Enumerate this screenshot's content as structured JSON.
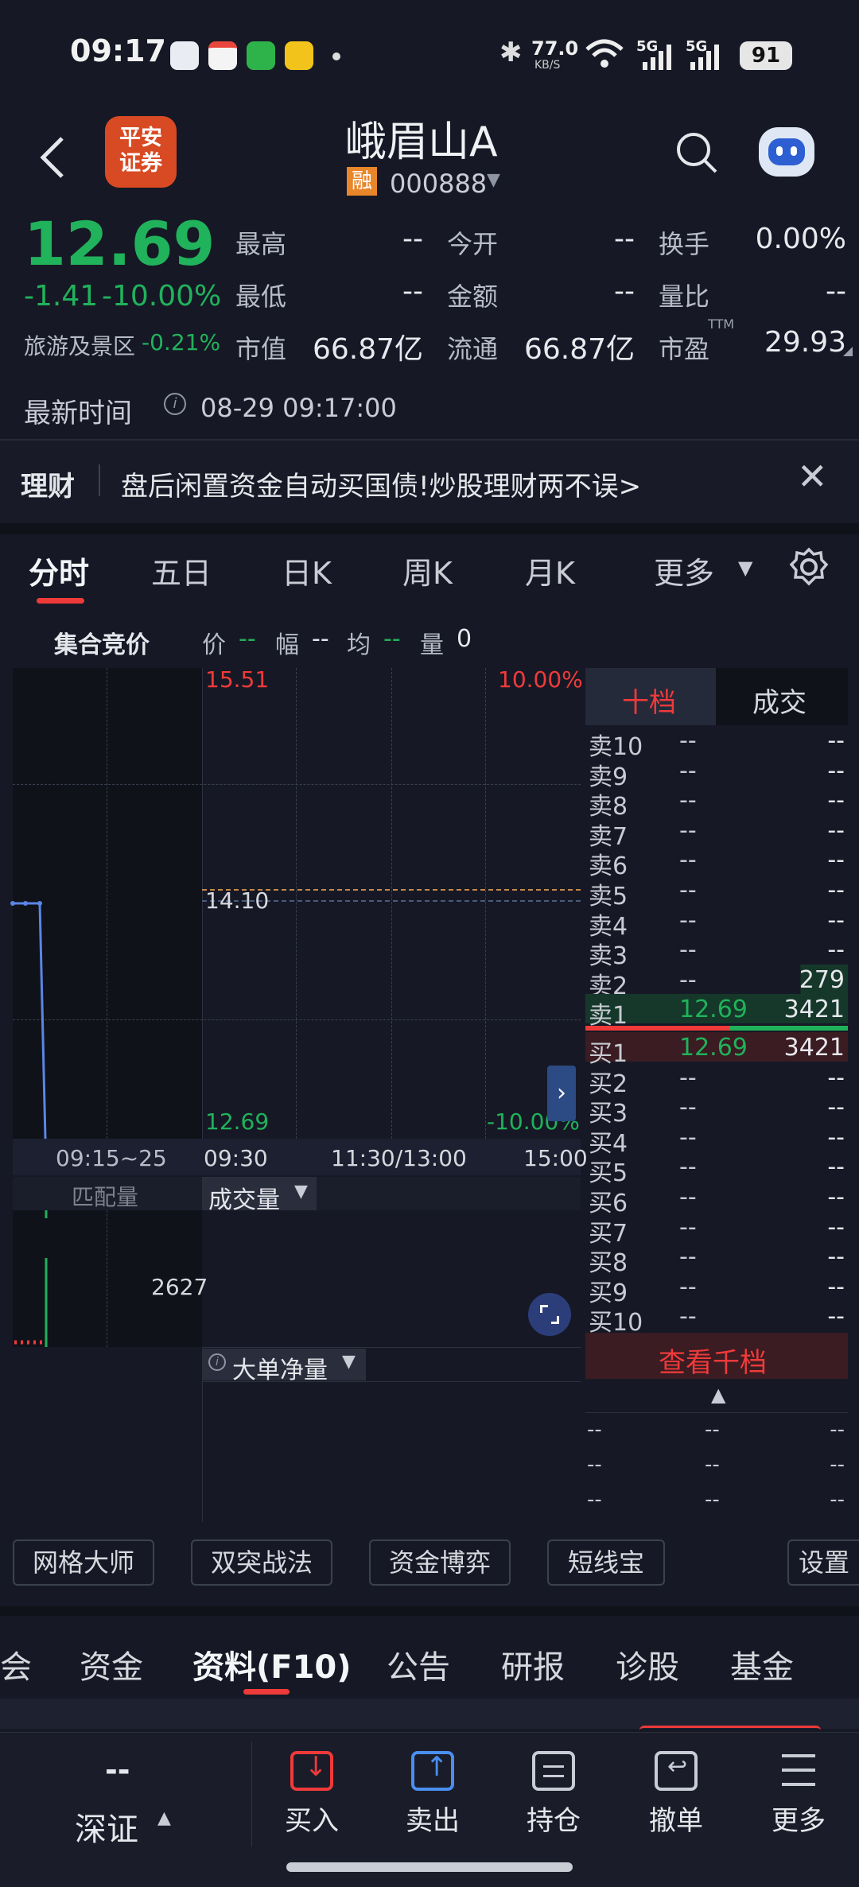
{
  "status_bar": {
    "time": "09:17",
    "net_speed": "77.0",
    "net_unit": "KB/S",
    "sig1": "5G",
    "sig2": "5G",
    "battery": "91"
  },
  "header": {
    "logo_text": "平安\n证券",
    "title": "峨眉山A",
    "rong_badge": "融",
    "code": "000888"
  },
  "quote": {
    "price": "12.69",
    "change": "-1.41",
    "change_pct": "-10.00%",
    "sector_name": "旅游及景区",
    "sector_change": "-0.21%",
    "fields": [
      {
        "label": "最高",
        "value": "--"
      },
      {
        "label": "今开",
        "value": "--"
      },
      {
        "label": "换手",
        "value": "0.00%"
      },
      {
        "label": "最低",
        "value": "--"
      },
      {
        "label": "金额",
        "value": "--"
      },
      {
        "label": "量比",
        "value": "--"
      },
      {
        "label": "市值",
        "value": "66.87亿"
      },
      {
        "label": "流通",
        "value": "66.87亿"
      },
      {
        "label": "市盈",
        "value": "29.93"
      }
    ],
    "ttm": "TTM",
    "update_label": "最新时间",
    "update_time": "08-29 09:17:00"
  },
  "banner": {
    "tag": "理财",
    "text": "盘后闲置资金自动买国债!炒股理财两不误>"
  },
  "chart_tabs": [
    "分时",
    "五日",
    "日K",
    "周K",
    "月K",
    "更多"
  ],
  "chart_info": {
    "mode": "集合竞价",
    "price_lbl": "价",
    "price_val": "--",
    "amp_lbl": "幅",
    "amp_val": "--",
    "avg_lbl": "均",
    "avg_val": "--",
    "vol_lbl": "量",
    "vol_val": "0"
  },
  "chart": {
    "price_top": "15.51",
    "price_mid": "14.10",
    "price_bottom": "12.69",
    "pct_top": "10.00%",
    "pct_bottom": "-10.00%",
    "time_auction": "09:15~25",
    "time_open": "09:30",
    "time_mid": "11:30/13:00",
    "time_close": "15:00",
    "match_vol_label": "匹配量",
    "volume_label": "成交量",
    "match_vol_value": "2627",
    "net_label": "大单净量"
  },
  "chart_data": {
    "type": "line",
    "series": [
      {
        "values": [
          14.1,
          14.1,
          14.1,
          12.69
        ]
      }
    ],
    "ylim": [
      12.69,
      15.51
    ],
    "volume_values": [
      2627
    ]
  },
  "order_book": {
    "tabs": [
      "十档",
      "成交"
    ],
    "asks": [
      {
        "label": "卖10",
        "price": "--",
        "vol": "--"
      },
      {
        "label": "卖9",
        "price": "--",
        "vol": "--"
      },
      {
        "label": "卖8",
        "price": "--",
        "vol": "--"
      },
      {
        "label": "卖7",
        "price": "--",
        "vol": "--"
      },
      {
        "label": "卖6",
        "price": "--",
        "vol": "--"
      },
      {
        "label": "卖5",
        "price": "--",
        "vol": "--"
      },
      {
        "label": "卖4",
        "price": "--",
        "vol": "--"
      },
      {
        "label": "卖3",
        "price": "--",
        "vol": "--"
      },
      {
        "label": "卖2",
        "price": "--",
        "vol": "279"
      },
      {
        "label": "卖1",
        "price": "12.69",
        "vol": "3421"
      }
    ],
    "bids": [
      {
        "label": "买1",
        "price": "12.69",
        "vol": "3421"
      },
      {
        "label": "买2",
        "price": "--",
        "vol": "--"
      },
      {
        "label": "买3",
        "price": "--",
        "vol": "--"
      },
      {
        "label": "买4",
        "price": "--",
        "vol": "--"
      },
      {
        "label": "买5",
        "price": "--",
        "vol": "--"
      },
      {
        "label": "买6",
        "price": "--",
        "vol": "--"
      },
      {
        "label": "买7",
        "price": "--",
        "vol": "--"
      },
      {
        "label": "买8",
        "price": "--",
        "vol": "--"
      },
      {
        "label": "买9",
        "price": "--",
        "vol": "--"
      },
      {
        "label": "买10",
        "price": "--",
        "vol": "--"
      }
    ],
    "qian_dang": "查看千档",
    "trades": [
      [
        "--",
        "--",
        "--"
      ],
      [
        "--",
        "--",
        "--"
      ],
      [
        "--",
        "--",
        "--"
      ]
    ]
  },
  "tools": [
    "网格大师",
    "双突战法",
    "资金博弈",
    "短线宝",
    "设置"
  ],
  "info_tabs": [
    "会",
    "资金",
    "资料(F10)",
    "公告",
    "研报",
    "诊股",
    "基金"
  ],
  "bottom_nav": {
    "market_dash": "--",
    "market": "深证",
    "items": [
      "买入",
      "卖出",
      "持仓",
      "撤单",
      "更多"
    ]
  }
}
